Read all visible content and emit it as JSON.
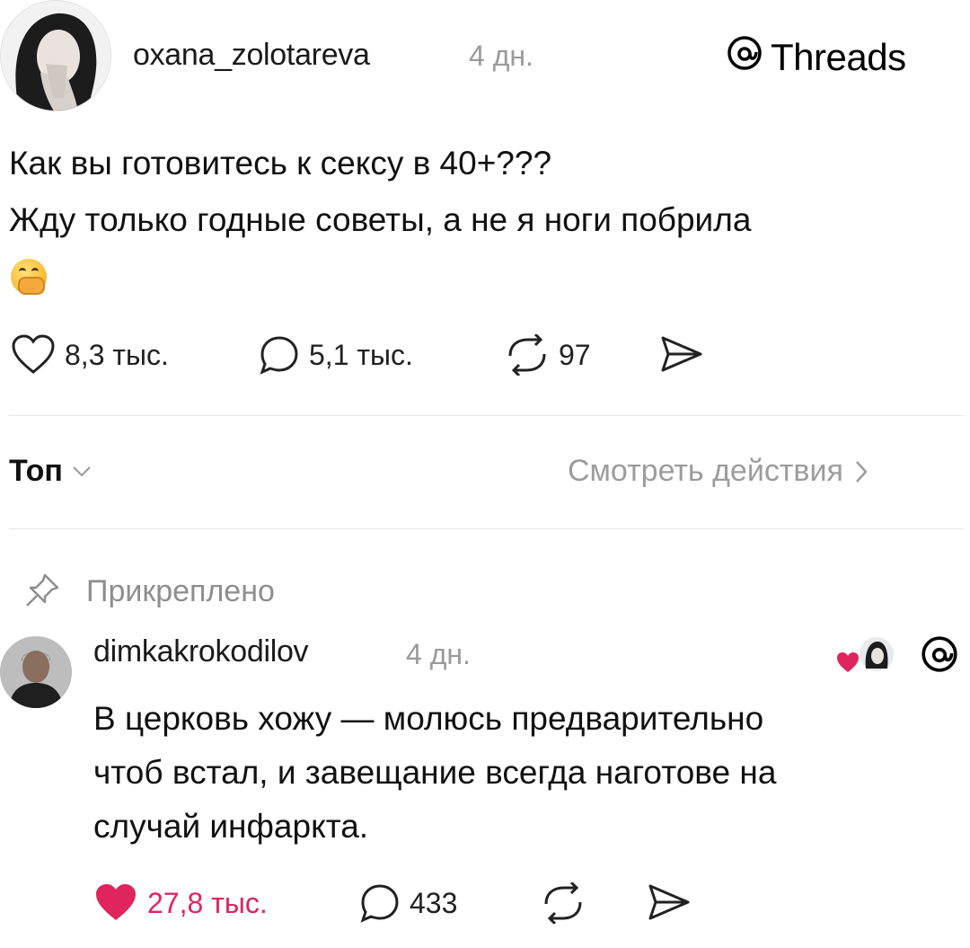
{
  "post": {
    "author": "oxana_zolotareva",
    "time": "4 дн.",
    "brand": "Threads",
    "lines": [
      "Как вы готовитесь к сексу в 40+???",
      "Жду только годные советы, а не я ноги побрила"
    ],
    "emoji": "hand-over-mouth-emoji",
    "likes": "8,3 тыс.",
    "comments": "5,1 тыс.",
    "reposts": "97"
  },
  "filter": {
    "sort_label": "Топ",
    "view_activity": "Смотреть действия"
  },
  "reply": {
    "pinned_label": "Прикреплено",
    "author": "dimkakrokodilov",
    "time": "4 дн.",
    "lines": [
      "В церковь хожу — молюсь предварительно",
      "чтоб встал, и завещание всегда наготове на",
      "случай инфаркта."
    ],
    "likes": "27,8 тыс.",
    "comments": "433"
  },
  "colors": {
    "accent_like": "#e0245e",
    "muted": "#9a9a9a"
  }
}
